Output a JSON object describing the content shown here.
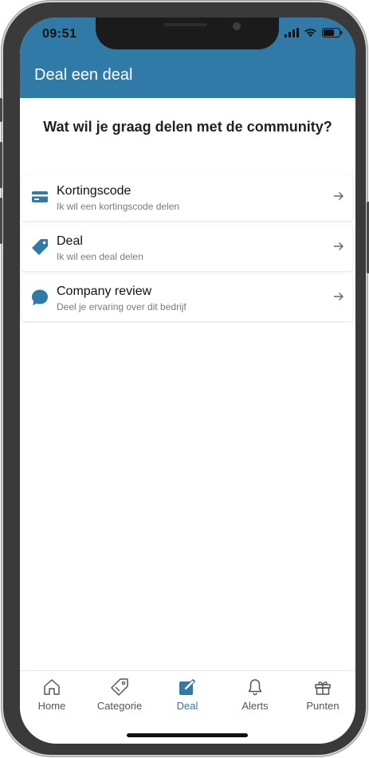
{
  "status_bar": {
    "time": "09:51"
  },
  "header": {
    "title": "Deal een deal"
  },
  "main": {
    "question": "Wat wil je graag delen met de community?",
    "options": [
      {
        "title": "Kortingscode",
        "subtitle": "Ik wil een kortingscode delen",
        "icon": "card-icon"
      },
      {
        "title": "Deal",
        "subtitle": "Ik wil een deal delen",
        "icon": "tag-icon"
      },
      {
        "title": "Company review",
        "subtitle": "Deel je ervaring over dit bedrijf",
        "icon": "chat-bubble-icon"
      }
    ]
  },
  "tabbar": {
    "tabs": [
      {
        "label": "Home",
        "icon": "home-icon",
        "active": false
      },
      {
        "label": "Categorie",
        "icon": "tag-outline-icon",
        "active": false
      },
      {
        "label": "Deal",
        "icon": "edit-icon",
        "active": true
      },
      {
        "label": "Alerts",
        "icon": "bell-icon",
        "active": false
      },
      {
        "label": "Punten",
        "icon": "gift-icon",
        "active": false
      }
    ]
  },
  "colors": {
    "brand": "#2f7aa6",
    "text": "#222222",
    "muted": "#7a7a7a"
  }
}
